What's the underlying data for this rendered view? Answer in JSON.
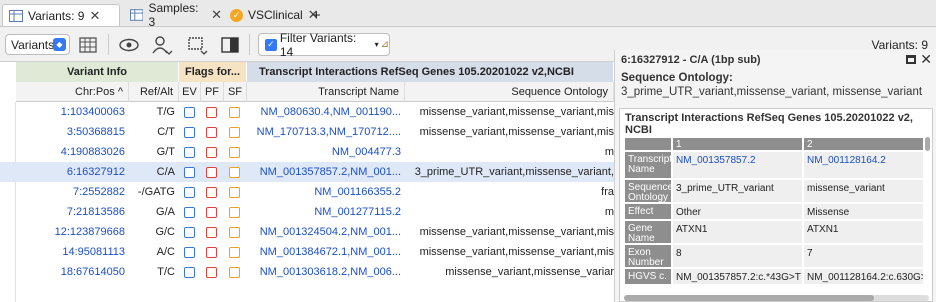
{
  "tabs": [
    {
      "label": "Variants: 9",
      "icon": "table-icon",
      "active": true
    },
    {
      "label": "Samples: 3",
      "icon": "table-icon",
      "active": false
    },
    {
      "label": "VSClinical",
      "icon": "vsclinical-icon",
      "active": false
    }
  ],
  "toolbar": {
    "view_select": "Variants",
    "filter_label": "Filter Variants: 14",
    "variant_count": "Variants: 9"
  },
  "grid": {
    "groups": [
      "Variant Info",
      "Flags for...",
      "Transcript Interactions RefSeq Genes 105.20201022 v2,NCBI"
    ],
    "headers": [
      "Chr:Pos ^",
      "Ref/Alt",
      "EV",
      "PF",
      "SF",
      "Transcript Name",
      "Sequence Ontology"
    ],
    "rows": [
      {
        "pos": "1:103400063",
        "refalt": "T/G",
        "tx": "NM_080630.4,NM_001190...",
        "so": "missense_variant,missense_variant,mis",
        "sel": false
      },
      {
        "pos": "3:50368815",
        "refalt": "C/T",
        "tx": "NM_170713.3,NM_170712....",
        "so": "missense_variant,missense_variant,mis",
        "sel": false
      },
      {
        "pos": "4:190883026",
        "refalt": "G/T",
        "tx": "NM_004477.3",
        "so": "m",
        "sel": false
      },
      {
        "pos": "6:16327912",
        "refalt": "C/A",
        "tx": "NM_001357857.2,NM_001...",
        "so": "3_prime_UTR_variant,missense_variant,",
        "sel": true
      },
      {
        "pos": "7:2552882",
        "refalt": "-/GATG",
        "tx": "NM_001166355.2",
        "so": "fra",
        "sel": false
      },
      {
        "pos": "7:21813586",
        "refalt": "G/A",
        "tx": "NM_001277115.2",
        "so": "m",
        "sel": false
      },
      {
        "pos": "12:123879668",
        "refalt": "G/C",
        "tx": "NM_001324504.2,NM_001...",
        "so": "missense_variant,missense_variant,mis",
        "sel": false
      },
      {
        "pos": "14:95081113",
        "refalt": "A/C",
        "tx": "NM_001384672.1,NM_001...",
        "so": "missense_variant,missense_variant,mis",
        "sel": false
      },
      {
        "pos": "18:67614050",
        "refalt": "T/C",
        "tx": "NM_001303618.2,NM_006...",
        "so": "missense_variant,missense_variar",
        "sel": false
      }
    ]
  },
  "panel": {
    "title": "6:16327912 - C/A (1bp sub)",
    "so_label": "Sequence Ontology:",
    "so_value": "3_prime_UTR_variant,missense_variant, missense_variant",
    "inner_title": "Transcript Interactions RefSeq Genes 105.20201022 v2, NCBI",
    "col_headers": [
      "",
      "1",
      "2"
    ],
    "rows": [
      {
        "key": "Transcript Name",
        "v1": "NM_001357857.2",
        "v2": "NM_001128164.2",
        "link": true
      },
      {
        "key": "Sequence Ontology",
        "v1": "3_prime_UTR_variant",
        "v2": "missense_variant",
        "link": false
      },
      {
        "key": "Effect",
        "v1": "Other",
        "v2": "Missense",
        "link": false
      },
      {
        "key": "Gene Name",
        "v1": "ATXN1",
        "v2": "ATXN1",
        "link": false
      },
      {
        "key": "Exon Number",
        "v1": "8",
        "v2": "7",
        "link": false
      },
      {
        "key": "HGVS c.",
        "v1": "NM_001357857.2:c.*43G>T",
        "v2": "NM_001128164.2:c.630G>",
        "link": false
      }
    ]
  },
  "colors": {
    "ev": "#3a78d8",
    "pf": "#e0403a",
    "sf": "#f0a020",
    "group1": "#dfe9d6",
    "group2": "#f6e3c4",
    "group3": "#d5dde9"
  }
}
